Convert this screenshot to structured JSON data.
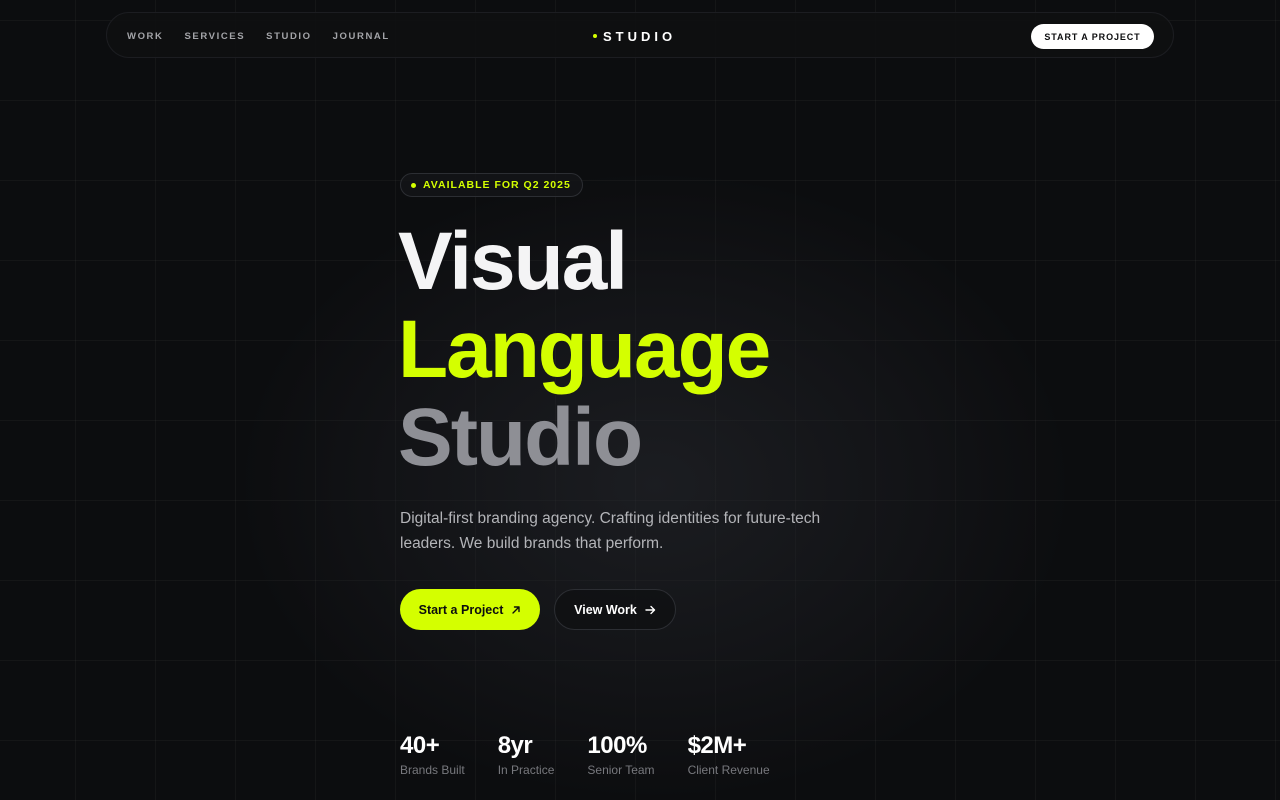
{
  "nav": {
    "links": [
      "WORK",
      "SERVICES",
      "STUDIO",
      "JOURNAL"
    ],
    "brand": "STUDIO",
    "cta_label": "START A PROJECT"
  },
  "hero": {
    "badge": "AVAILABLE FOR Q2 2025",
    "headline": [
      "Visual",
      "Language",
      "Studio"
    ],
    "subtext": "Digital-first branding agency. Crafting identities for future-tech leaders. We build brands that perform.",
    "primary_button": "Start a Project",
    "secondary_button": "View Work"
  },
  "stats": [
    {
      "value": "40+",
      "label": "Brands Built"
    },
    {
      "value": "8yr",
      "label": "In Practice"
    },
    {
      "value": "100%",
      "label": "Senior Team"
    },
    {
      "value": "$2M+",
      "label": "Client Revenue"
    }
  ],
  "icons": {
    "brand_dot": "dot-icon",
    "badge_dot": "status-dot-icon",
    "primary_button_icon": "arrow-up-right-icon",
    "secondary_button_icon": "arrow-right-icon"
  },
  "colors": {
    "accent": "#d4ff00",
    "background": "#0c0d0f",
    "muted_text": "#8e8f95"
  }
}
